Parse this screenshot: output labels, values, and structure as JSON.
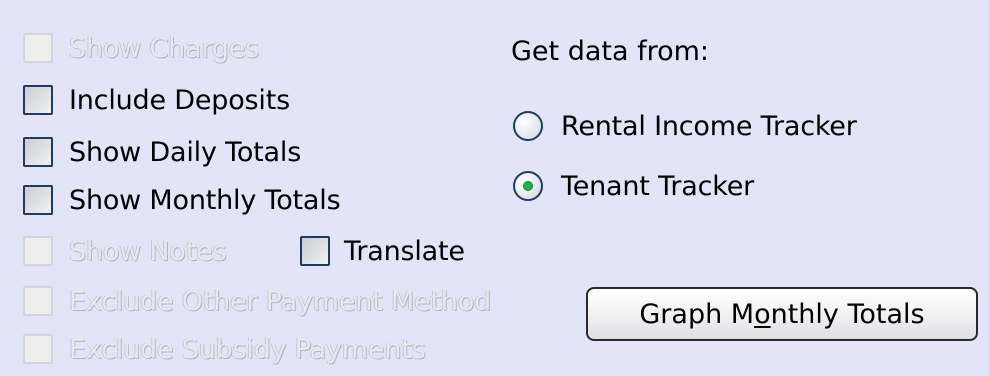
{
  "options": {
    "show_charges": {
      "label": "Show Charges",
      "checked": false,
      "enabled": false
    },
    "include_deposits": {
      "label": "Include Deposits",
      "checked": false,
      "enabled": true
    },
    "show_daily_totals": {
      "label": "Show Daily Totals",
      "checked": false,
      "enabled": true
    },
    "show_monthly_totals": {
      "label": "Show Monthly Totals",
      "checked": false,
      "enabled": true
    },
    "show_notes": {
      "label": "Show Notes",
      "checked": false,
      "enabled": false
    },
    "translate": {
      "label": "Translate",
      "checked": false,
      "enabled": true
    },
    "exclude_other_payment_method": {
      "label": "Exclude Other Payment Method",
      "checked": false,
      "enabled": false
    },
    "exclude_subsidy_payments": {
      "label": "Exclude Subsidy Payments",
      "checked": false,
      "enabled": false
    }
  },
  "data_source": {
    "heading": "Get data from:",
    "choices": [
      {
        "label": "Rental Income Tracker",
        "selected": false
      },
      {
        "label": "Tenant Tracker",
        "selected": true
      }
    ]
  },
  "graph_button": {
    "label_before": "Graph M",
    "label_mnemonic": "o",
    "label_after": "nthly Totals"
  },
  "colors": {
    "panel_background": "#e4e4f8",
    "radio_selected_dot": "#22b14c",
    "checkbox_border": "#1f3a66"
  }
}
